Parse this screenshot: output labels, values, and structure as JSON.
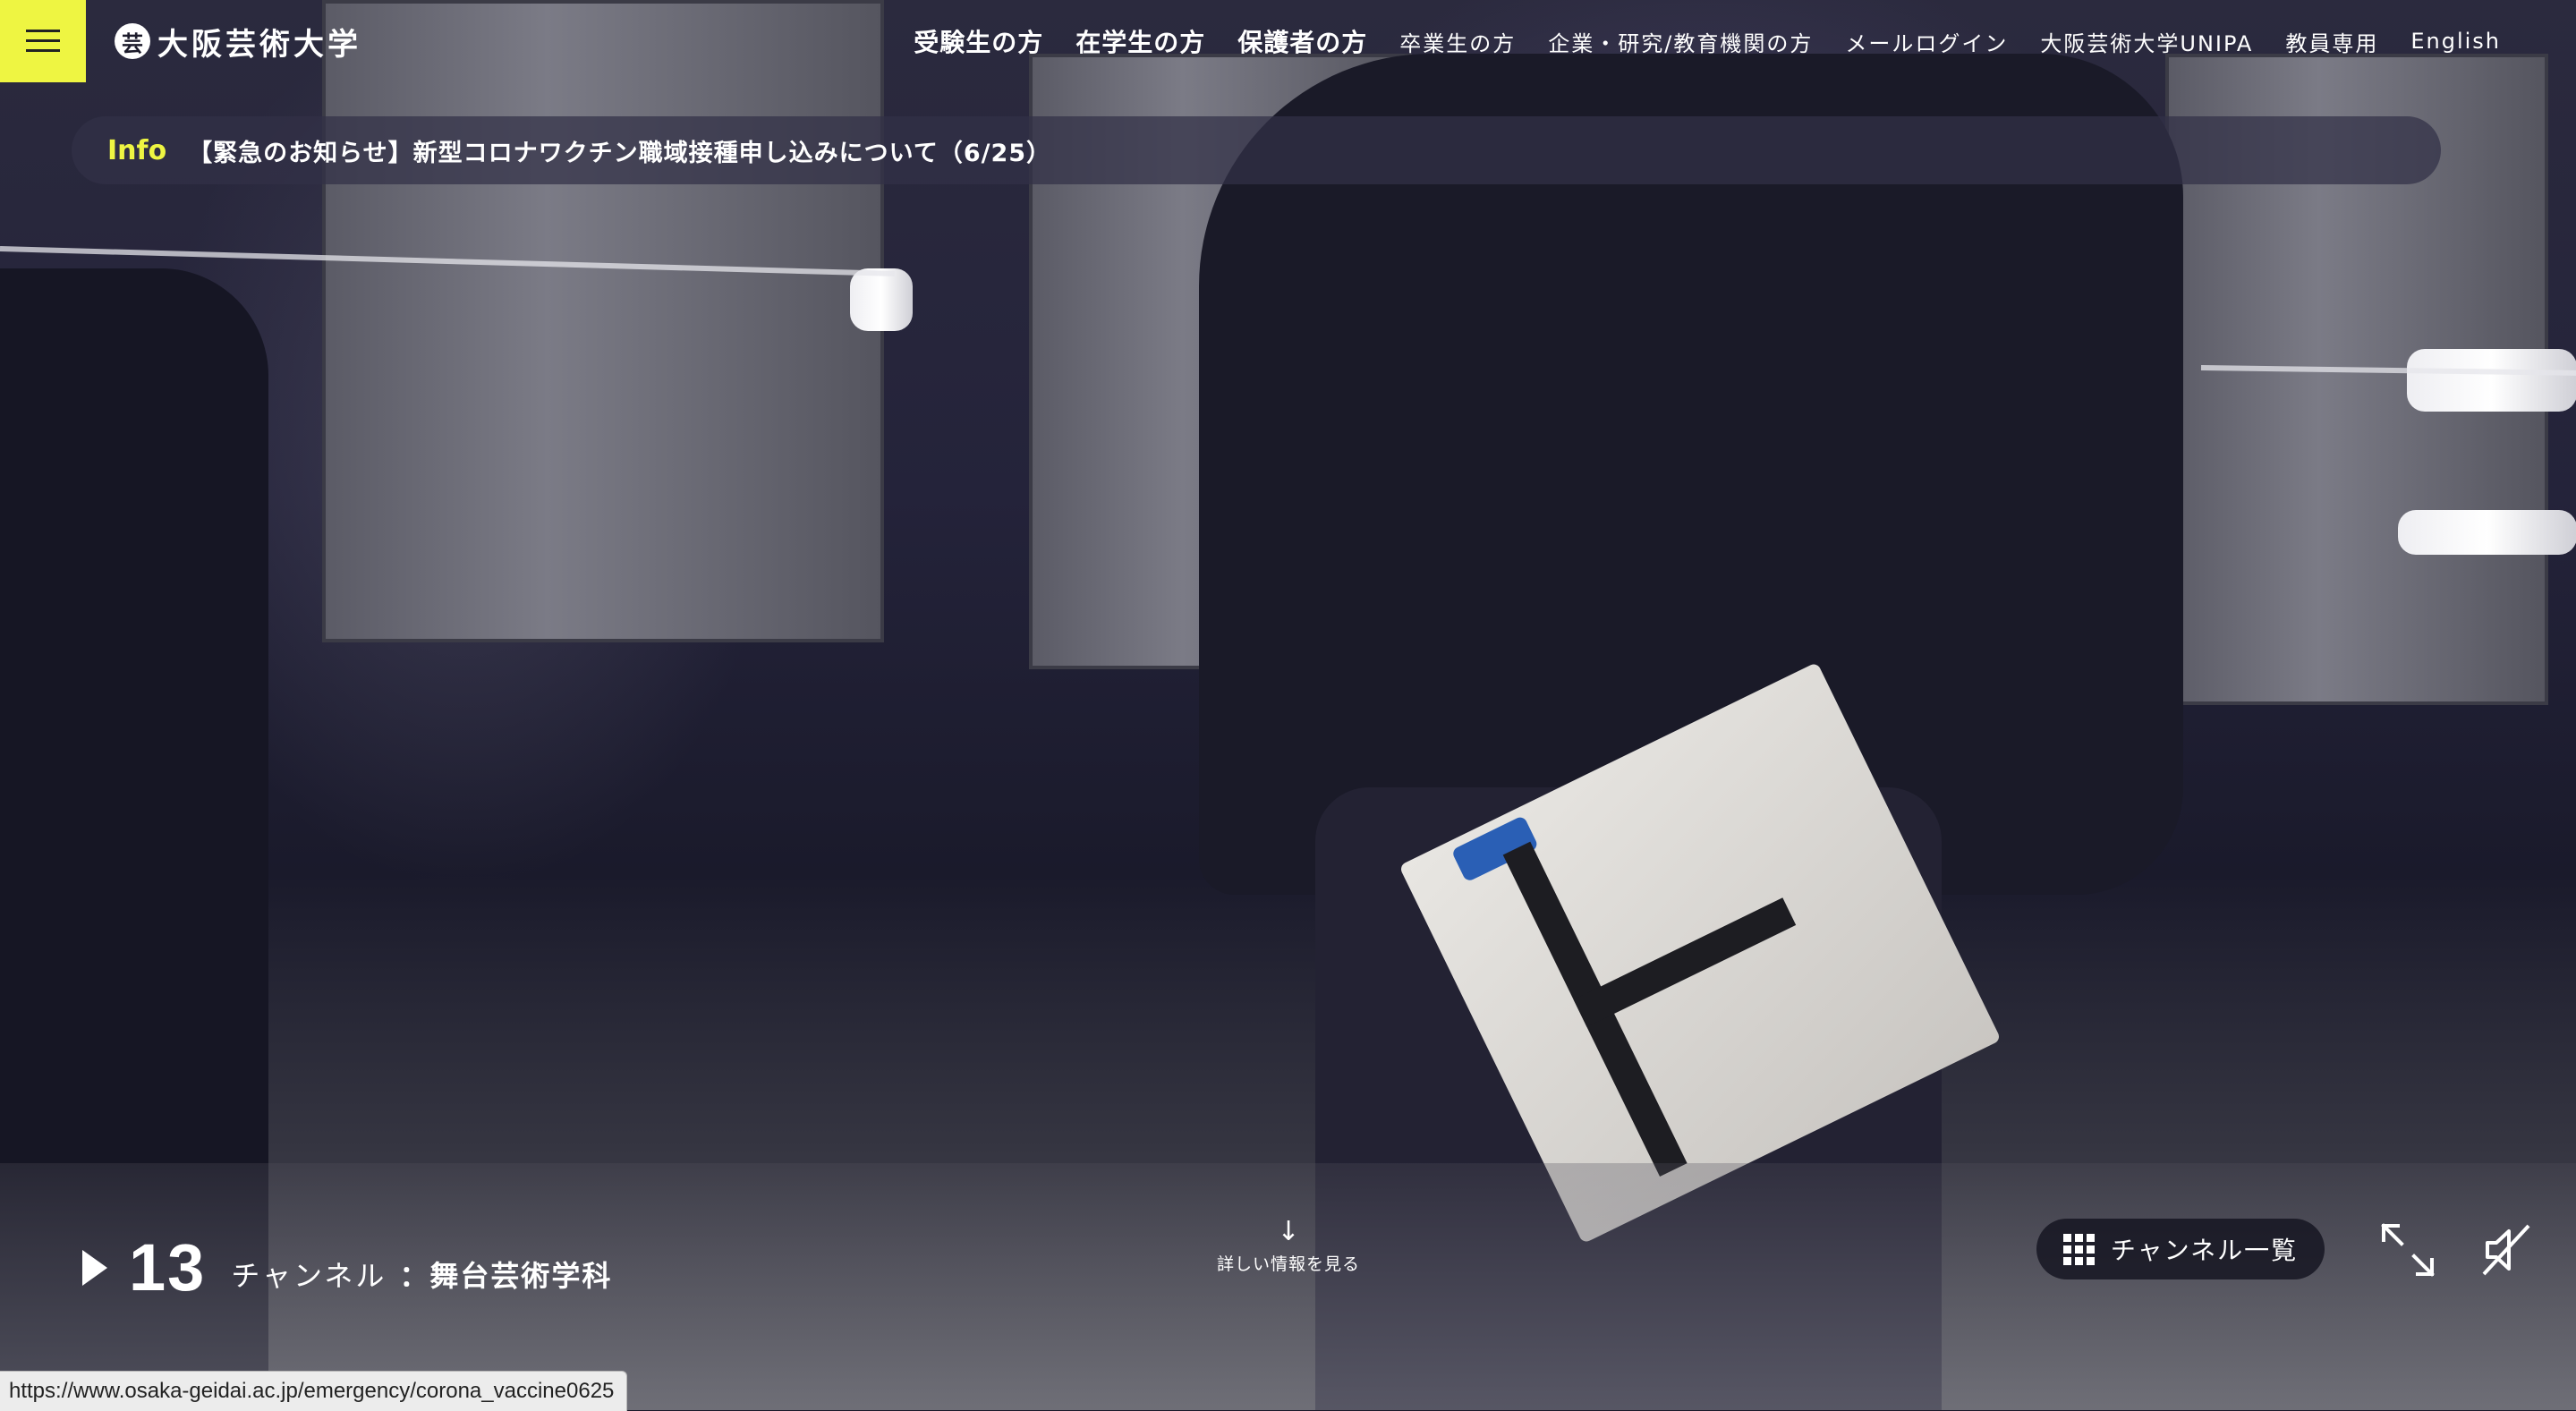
{
  "header": {
    "logo_mark": "芸",
    "logo_text": "大阪芸術大学",
    "nav": [
      {
        "label": "受験生の方"
      },
      {
        "label": "在学生の方"
      },
      {
        "label": "保護者の方"
      },
      {
        "label": "卒業生の方"
      },
      {
        "label": "企業・研究/教育機関の方"
      },
      {
        "label": "メールログイン"
      },
      {
        "label": "大阪芸術大学UNIPA"
      },
      {
        "label": "教員専用"
      },
      {
        "label": "English"
      }
    ]
  },
  "info": {
    "label": "Info",
    "text": "【緊急のお知らせ】新型コロナワクチン職域接種申し込みについて（6/25）"
  },
  "channel": {
    "number": "13",
    "word": "チャンネル",
    "name": "：舞台芸術学科"
  },
  "scroll_more": {
    "arrow": "↓",
    "label": "詳しい情報を見る"
  },
  "channel_list": {
    "label": "チャンネル一覧"
  },
  "status_bar": {
    "url": "https://www.osaka-geidai.ac.jp/emergency/corona_vaccine0625"
  },
  "colors": {
    "accent": "#eef542",
    "overlay": "#1b1a2a"
  },
  "icons": [
    "menu-icon",
    "logo-icon",
    "play-icon",
    "arrow-down-icon",
    "grid-icon",
    "expand-icon",
    "mute-icon"
  ]
}
